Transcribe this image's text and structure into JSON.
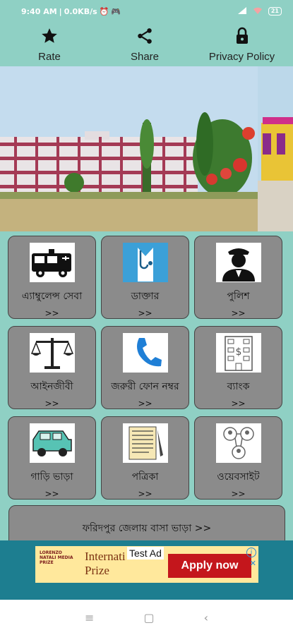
{
  "status_bar": {
    "time": "9:40 AM",
    "network_speed": "0.0KB/s",
    "battery": "21"
  },
  "top_actions": [
    {
      "label": "Rate",
      "icon": "star-icon"
    },
    {
      "label": "Share",
      "icon": "share-icon"
    },
    {
      "label": "Privacy Policy",
      "icon": "lock-icon"
    }
  ],
  "tiles": [
    {
      "label": "এ্যাম্বুলেন্স সেবা",
      "arrow": ">>",
      "icon": "ambulance-icon"
    },
    {
      "label": "ডাক্তার",
      "arrow": ">>",
      "icon": "doctor-icon"
    },
    {
      "label": "পুলিশ",
      "arrow": ">>",
      "icon": "police-icon"
    },
    {
      "label": "আইনজীবী",
      "arrow": ">>",
      "icon": "scales-icon"
    },
    {
      "label": "জরুরী ফোন নম্বর",
      "arrow": ">>",
      "icon": "phone-icon"
    },
    {
      "label": "ব্যাংক",
      "arrow": ">>",
      "icon": "bank-icon"
    },
    {
      "label": "গাড়ি ভাড়া",
      "arrow": ">>",
      "icon": "car-icon"
    },
    {
      "label": "পত্রিকা",
      "arrow": ">>",
      "icon": "newspaper-icon"
    },
    {
      "label": "ওয়েবসাইট",
      "arrow": ">>",
      "icon": "website-icon"
    }
  ],
  "wide_tile": {
    "label": "ফরিদপুর জেলায় বাসা ভাড়া >>"
  },
  "ad": {
    "badge": "Test Ad",
    "title_line1": "Internati",
    "title_line2": "Prize",
    "logo_text": "LORENZO NATALI MEDIA PRIZE",
    "button": "Apply now",
    "info": "i",
    "close": "✕"
  },
  "colors": {
    "accent": "#8fd0c4",
    "tile": "#8b8b8b",
    "ad_bg": "#1d7e90",
    "ad_button": "#c4161c"
  }
}
